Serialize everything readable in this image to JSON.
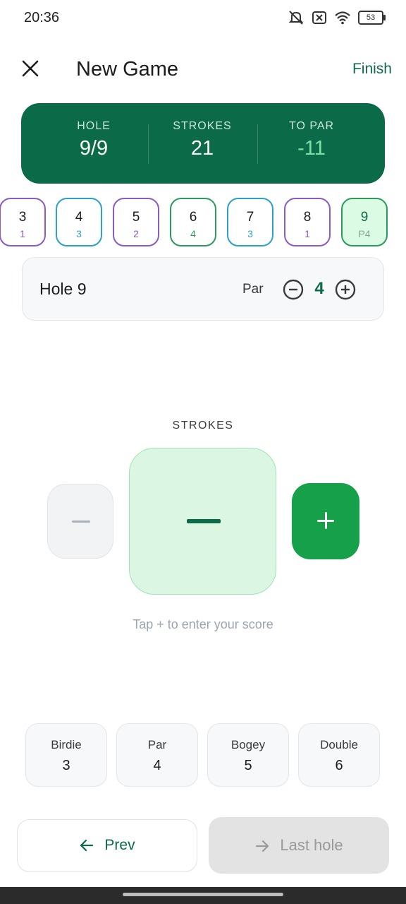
{
  "status_bar": {
    "time": "20:36",
    "battery": "53"
  },
  "header": {
    "title": "New Game",
    "finish_label": "Finish"
  },
  "summary": {
    "hole_label": "HOLE",
    "hole_value": "9/9",
    "strokes_label": "STROKES",
    "strokes_value": "21",
    "to_par_label": "TO PAR",
    "to_par_value": "-11"
  },
  "holes": [
    {
      "number": "3",
      "score": "1",
      "color": "#8b5ac4"
    },
    {
      "number": "4",
      "score": "3",
      "color": "#2aa2c4"
    },
    {
      "number": "5",
      "score": "2",
      "color": "#8b5ac4"
    },
    {
      "number": "6",
      "score": "4",
      "color": "#2a9b5c"
    },
    {
      "number": "7",
      "score": "3",
      "color": "#2aa2c4"
    },
    {
      "number": "8",
      "score": "1",
      "color": "#8b5ac4"
    },
    {
      "number": "9",
      "score": "P4",
      "color": "#2a9b5c",
      "active": true
    }
  ],
  "current_hole": {
    "title": "Hole 9",
    "par_label": "Par",
    "par_value": "4"
  },
  "strokes": {
    "label": "STROKES",
    "hint": "Tap + to enter your score"
  },
  "quick_scores": [
    {
      "label": "Birdie",
      "value": "3"
    },
    {
      "label": "Par",
      "value": "4"
    },
    {
      "label": "Bogey",
      "value": "5"
    },
    {
      "label": "Double",
      "value": "6"
    }
  ],
  "nav": {
    "prev_label": "Prev",
    "next_label": "Last hole"
  },
  "colors": {
    "primary": "#0b6a47",
    "accent_green": "#17a04a",
    "to_par": "#7ee0a3"
  }
}
